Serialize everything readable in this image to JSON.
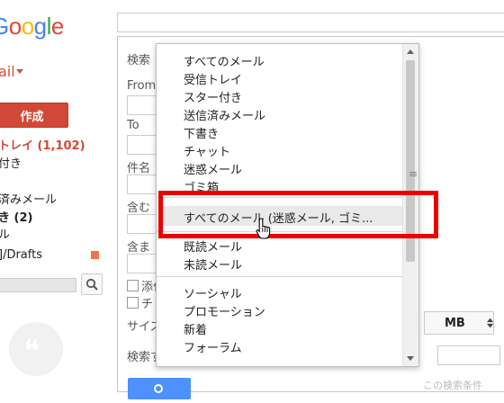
{
  "logo": {
    "text_parts": [
      "o",
      "o",
      "g",
      "l",
      "e"
    ]
  },
  "sidebar": {
    "mail_label": "ail",
    "compose_label": "作成",
    "nav": {
      "inbox": "トレイ (1,102)",
      "starred": "付き",
      "sent": "済みメール",
      "drafts": "き (2)",
      "all": "ル",
      "label_drafts": "]/Drafts"
    },
    "label_color": "#f4733b"
  },
  "form": {
    "search_label": "検索",
    "from_label": "From",
    "to_label": "To",
    "subject_label": "件名",
    "has_words_label": "含む",
    "doesnt_have_label": "含ま",
    "attachment_label": "添付",
    "chat_label": "チ",
    "size_label": "サイズ",
    "size_unit": "MB",
    "date_label": "検索す",
    "footer_note": "この検索条件"
  },
  "dropdown": {
    "group1": [
      "すべてのメール",
      "受信トレイ",
      "スター付き",
      "送信済みメール",
      "下書き",
      "チャット",
      "迷惑メール",
      "ゴミ箱"
    ],
    "highlighted": "すべてのメール (迷惑メール, ゴミ...",
    "group2": [
      "既読メール",
      "未読メール"
    ],
    "group3": [
      "ソーシャル",
      "プロモーション",
      "新着",
      "フォーラム"
    ]
  },
  "colors": {
    "compose": "#d14836",
    "highlight_box": "#ee0000",
    "search_button": "#4d90fe"
  },
  "icons": {
    "search": "search-icon",
    "hangouts": "hangouts-quote-icon",
    "cursor": "hand-pointer-icon"
  }
}
